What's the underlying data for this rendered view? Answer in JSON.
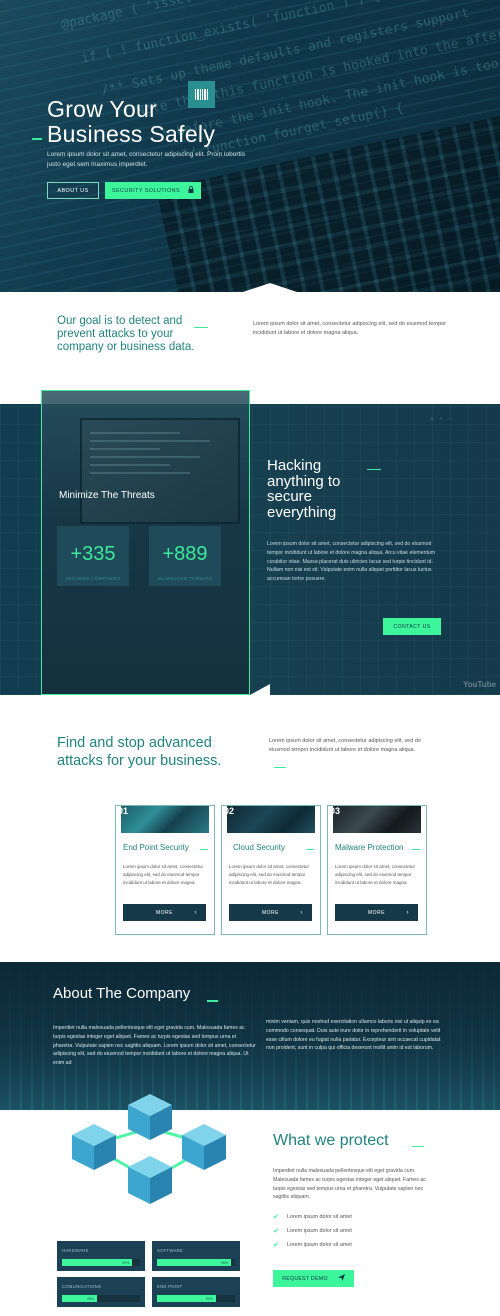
{
  "colors": {
    "accent": "#3df59b",
    "teal": "#21837e",
    "navy": "#16394a",
    "hero_bg": "#10384a"
  },
  "hero": {
    "title": "Grow Your Business Safely",
    "text": "Lorem ipsum dolor sit amet, consectetur adipiscing elit. Proin lobortis justo eget sem maximus imperdiet.",
    "about_button": "ABOUT US",
    "solutions_button": "SECURITY SOLUTIONS",
    "icons": {
      "hero_icon": "barcode-icon",
      "solutions_icon": "lock-icon"
    },
    "code_lines": [
      "@package  (   'isset' (  'function_exists( 'incode_s",
      "if ( ! function_exists( 'function ) ) {",
      "/** Sets up theme defaults and registers support",
      "* Note that this function is hooked into the after_",
      "* before the init hook. The init hook is too late",
      "*/ function fourget_setup() {"
    ]
  },
  "goal": {
    "title": "Our goal is to detect and prevent attacks to your company or business data.",
    "text": "Lorem ipsum dolor sit amet, consectetur adipiscing elit, sed do eiusmod tempor incididunt ut labore et dolore magna aliqua."
  },
  "threats": {
    "card_title": "Minimize The Threats",
    "stats": [
      {
        "value": "+335",
        "label": "SECURED COMPANIES"
      },
      {
        "value": "+889",
        "label": "ELIMINATED THREATS"
      }
    ],
    "heading": "Hacking anything to secure everything",
    "text": "Lorem ipsum dolor sit amet, consectetur adipiscing elit, sed do eiusmod tempor incididunt ut labore et dolore magna aliqua. Arcu vitae elementum curabitur vitae. Massa placerat duis ultricies lacus sed turpis tincidunt id. Nullam non nisi est sit. Vulputate enim nulla aliquet porttitor lacus luctus accumsan tortor posuere.",
    "contact_button": "CONTACT US",
    "watermark": "YouTube"
  },
  "find": {
    "title": "Find and stop advanced attacks for your business.",
    "text": "Lorem ipsum dolor sit amet, consectetur adipiscing elit, sed do eiusmod tempor incididunt ut labore et dolore magna aliqua."
  },
  "services": [
    {
      "num": "01",
      "title": "End Point Security",
      "desc": "Lorem ipsum dolor sit amet, consectetur adipiscing elit, sed do eiusmod tempor incididunt ut labore et dolore magna.",
      "button": "MORE"
    },
    {
      "num": "02",
      "title": "Cloud Security",
      "desc": "Lorem ipsum dolor sit amet, consectetur adipiscing elit, sed do eiusmod tempor incididunt ut labore et dolore magna.",
      "button": "MORE"
    },
    {
      "num": "03",
      "title": "Malware Protection",
      "desc": "Lorem ipsum dolor sit amet, consectetur adipiscing elit, sed do eiusmod tempor incididunt ut labore et dolore magna.",
      "button": "MORE"
    }
  ],
  "about": {
    "title": "About The Company",
    "left_text": "Imperdiet nulla malesuada pellentesque elit eget gravida cum. Malesuada fames ac turpis egestas integer eget aliquet. Fames ac turpis egestas sed tempus urna et pharetra. Vulputate sapien nec sagittis aliquam. Lorem ipsum dolor sit amet, consectetur adipiscing elit, sed do eiusmod tempor incididunt ut labore et dolore magna aliqua. Ut enim ad",
    "right_text": "minim veniam, quis nostrud exercitation ullamco laboris nisi ut aliquip ex ea commodo consequat. Duis aute irure dolor in reprehenderit in voluptate velit esse cillum dolore eu fugiat nulla pariatur. Excepteur sint occaecat cupidatat non proident, sunt in culpa qui officia deserunt mollit anim id est laborum."
  },
  "protect": {
    "title": "What we protect",
    "text": "Imperdiet nulla malesuada pellentesque elit eget gravida cum. Malesuada fames ac turpis egestas integer eget aliquet. Fames ac turpis egestas sed tempus urna et pharetra. Vulputate sapien nec sagittis aliquam.",
    "checks": [
      "Lorem ipsum dolor sit amet",
      "Lorem ipsum dolor sit amet",
      "Lorem ipsum dolor sit amet"
    ],
    "demo_button": "REQUEST DEMO",
    "bars": [
      {
        "label": "HARDWARE",
        "percent": 90,
        "display": "90%"
      },
      {
        "label": "SOFTWARE",
        "percent": 95,
        "display": "95%"
      },
      {
        "label": "COMUNICATIONS",
        "percent": 45,
        "display": "45%"
      },
      {
        "label": "END POINT",
        "percent": 75,
        "display": "75%"
      }
    ]
  }
}
